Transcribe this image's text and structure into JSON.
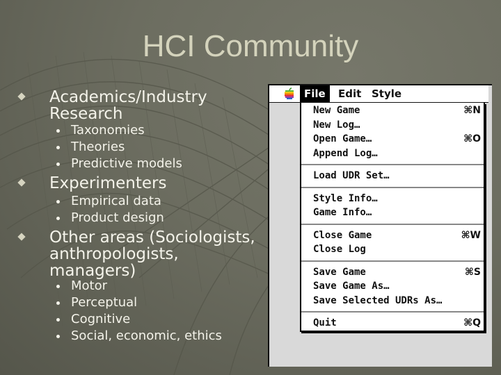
{
  "slide": {
    "title": "HCI Community",
    "bullets": [
      {
        "text": "Academics/Industry Research",
        "lines": [
          "Academics/Industry",
          "Research"
        ],
        "sub": [
          "Taxonomies",
          "Theories",
          "Predictive models"
        ]
      },
      {
        "text": "Experimenters",
        "lines": [
          "Experimenters"
        ],
        "sub": [
          "Empirical data",
          "Product design"
        ]
      },
      {
        "text": "Other areas (Sociologists, anthropologists, managers)",
        "lines": [
          "Other areas (Sociologists,",
          "anthropologists,",
          "managers)"
        ],
        "sub": [
          "Motor",
          "Perceptual",
          "Cognitive",
          "Social, economic, ethics"
        ]
      }
    ]
  },
  "screenshot": {
    "menubar": {
      "apple_icon": "apple-rainbow-icon",
      "items": [
        "File",
        "Edit",
        "Style"
      ],
      "active": "File"
    },
    "file_menu": {
      "groups": [
        [
          {
            "label": "New Game",
            "shortcut": "⌘N"
          },
          {
            "label": "New Log…",
            "shortcut": ""
          },
          {
            "label": "Open Game…",
            "shortcut": "⌘O"
          },
          {
            "label": "Append Log…",
            "shortcut": ""
          }
        ],
        [
          {
            "label": "Load UDR Set…",
            "shortcut": ""
          }
        ],
        [
          {
            "label": "Style Info…",
            "shortcut": ""
          },
          {
            "label": "Game Info…",
            "shortcut": ""
          }
        ],
        [
          {
            "label": "Close Game",
            "shortcut": "⌘W"
          },
          {
            "label": "Close Log",
            "shortcut": ""
          }
        ],
        [
          {
            "label": "Save Game",
            "shortcut": "⌘S"
          },
          {
            "label": "Save Game As…",
            "shortcut": ""
          },
          {
            "label": "Save Selected UDRs As…",
            "shortcut": ""
          }
        ],
        [
          {
            "label": "Quit",
            "shortcut": "⌘Q"
          }
        ]
      ]
    }
  }
}
